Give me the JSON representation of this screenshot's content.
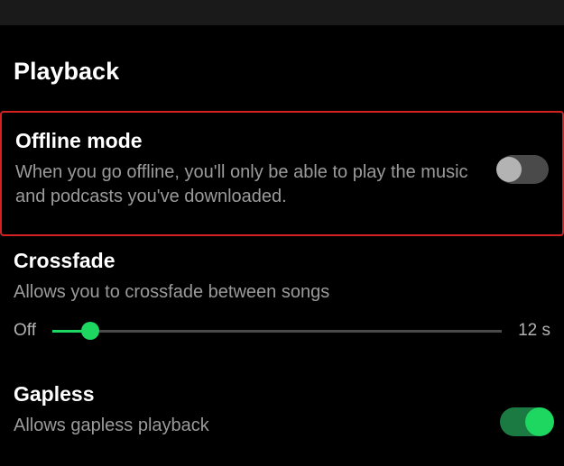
{
  "section": {
    "title": "Playback"
  },
  "offline": {
    "title": "Offline mode",
    "description": "When you go offline, you'll only be able to play the music and podcasts you've downloaded.",
    "enabled": false
  },
  "crossfade": {
    "title": "Crossfade",
    "description": "Allows you to crossfade between songs",
    "min_label": "Off",
    "max_label": "12 s",
    "value_percent": 8.5
  },
  "gapless": {
    "title": "Gapless",
    "description": "Allows gapless playback",
    "enabled": true
  }
}
